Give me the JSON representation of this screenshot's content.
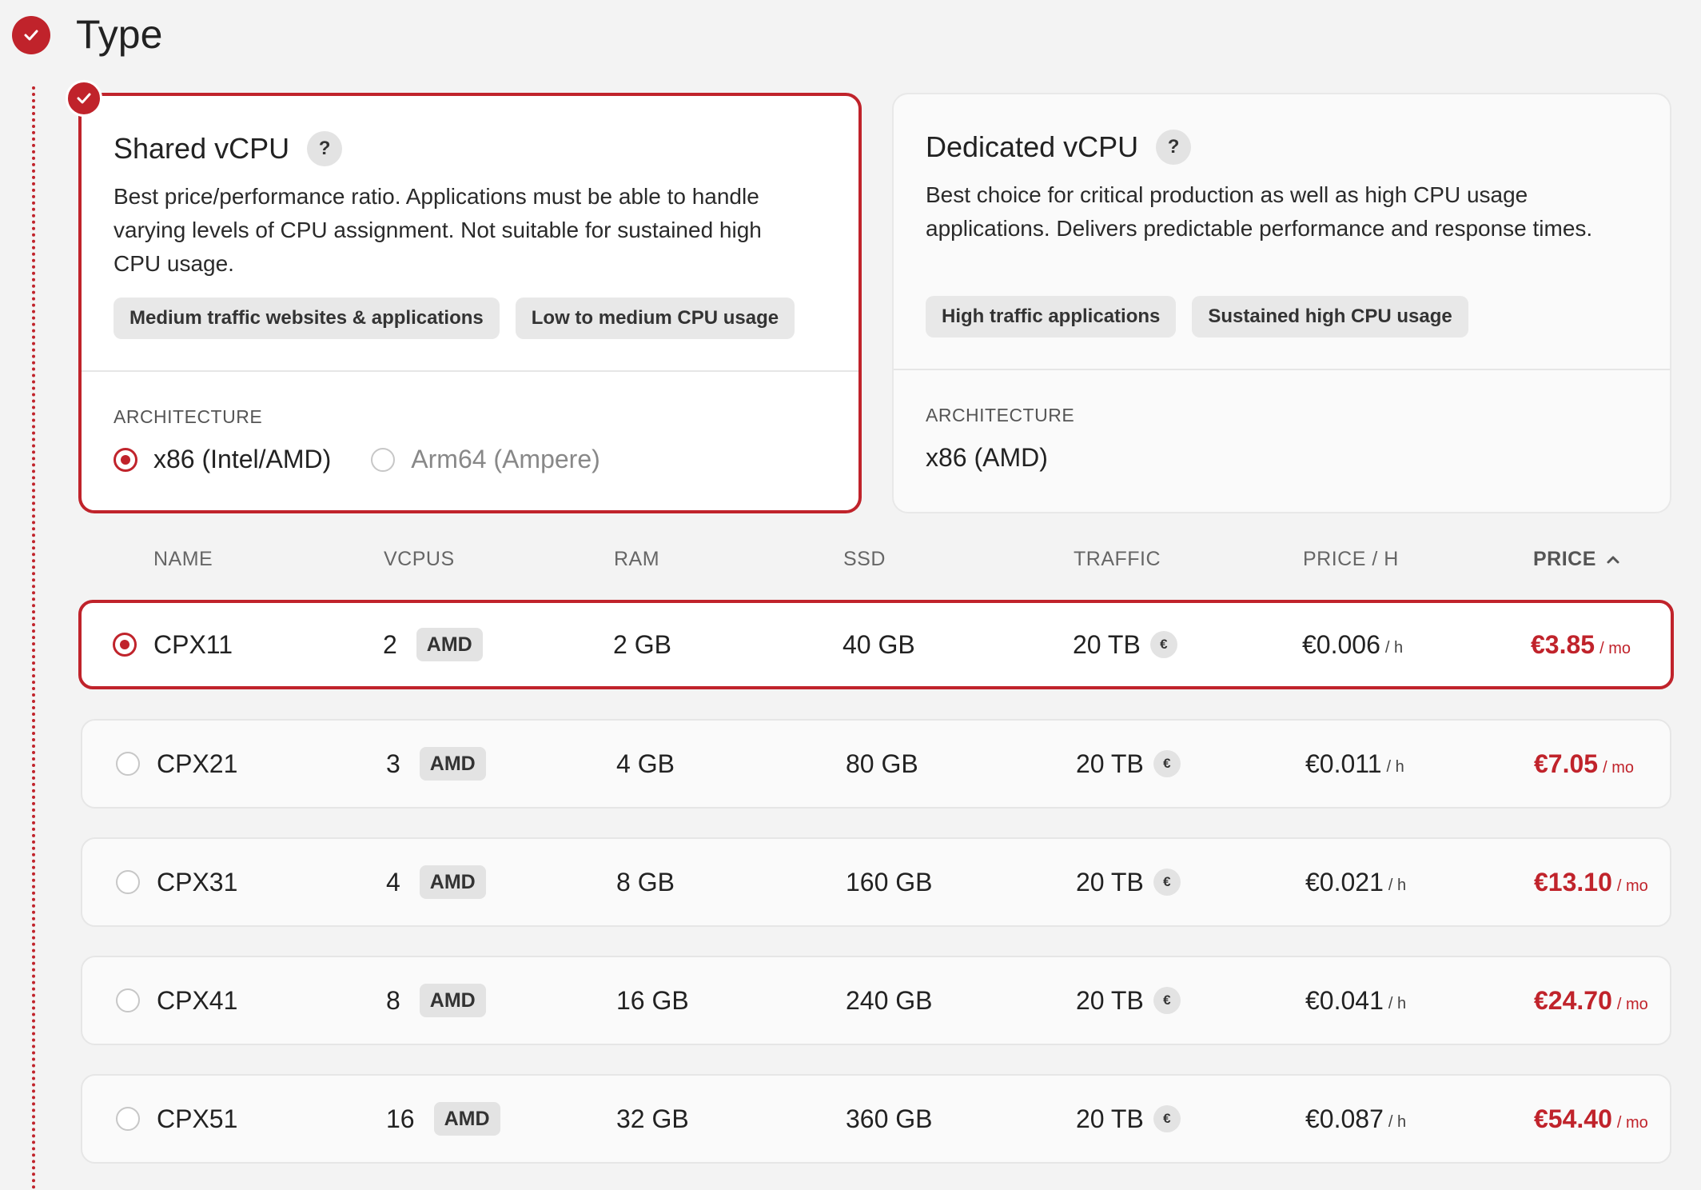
{
  "step": {
    "title": "Type",
    "icon": "check-icon"
  },
  "cards": {
    "shared": {
      "title": "Shared vCPU",
      "help": "?",
      "description": "Best price/performance ratio. Applications must be able to handle varying levels of CPU assignment. Not suitable for sustained high CPU usage.",
      "tags": [
        "Medium traffic websites & applications",
        "Low to medium CPU usage"
      ],
      "arch_label": "ARCHITECTURE",
      "arch_options": [
        "x86 (Intel/AMD)",
        "Arm64 (Ampere)"
      ],
      "selected": true
    },
    "dedicated": {
      "title": "Dedicated vCPU",
      "help": "?",
      "description": "Best choice for critical production as well as high CPU usage applications. Delivers predictable performance and response times.",
      "tags": [
        "High traffic applications",
        "Sustained high CPU usage"
      ],
      "arch_label": "ARCHITECTURE",
      "arch_value": "x86 (AMD)",
      "selected": false
    }
  },
  "table": {
    "headers": [
      "NAME",
      "VCPUS",
      "RAM",
      "SSD",
      "TRAFFIC",
      "PRICE / H",
      "PRICE"
    ],
    "vendor_badge": "AMD",
    "currency_badge": "€",
    "hour_unit": "/ h",
    "month_unit": "/ mo",
    "rows": [
      {
        "name": "CPX11",
        "vcpus": "2",
        "ram": "2 GB",
        "ssd": "40 GB",
        "traffic": "20 TB",
        "price_h": "€0.006",
        "price_mo": "€3.85"
      },
      {
        "name": "CPX21",
        "vcpus": "3",
        "ram": "4 GB",
        "ssd": "80 GB",
        "traffic": "20 TB",
        "price_h": "€0.011",
        "price_mo": "€7.05"
      },
      {
        "name": "CPX31",
        "vcpus": "4",
        "ram": "8 GB",
        "ssd": "160 GB",
        "traffic": "20 TB",
        "price_h": "€0.021",
        "price_mo": "€13.10"
      },
      {
        "name": "CPX41",
        "vcpus": "8",
        "ram": "16 GB",
        "ssd": "240 GB",
        "traffic": "20 TB",
        "price_h": "€0.041",
        "price_mo": "€24.70"
      },
      {
        "name": "CPX51",
        "vcpus": "16",
        "ram": "32 GB",
        "ssd": "360 GB",
        "traffic": "20 TB",
        "price_h": "€0.087",
        "price_mo": "€54.40"
      }
    ]
  },
  "colors": {
    "accent": "#c0232b",
    "background": "#f3f3f3",
    "tag_bg": "#e8e8e8"
  }
}
